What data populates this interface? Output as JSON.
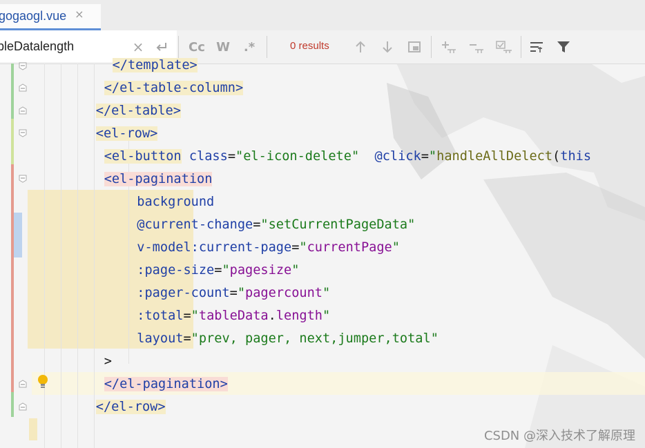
{
  "tab": {
    "label": "gogaogl.vue",
    "close": "×"
  },
  "search": {
    "value": "bleDatalength",
    "results": "0 results",
    "icons": [
      "clear-icon",
      "replace-arrow-icon",
      "match-case-icon",
      "words-icon",
      "regex-icon",
      "prev-occurrence-icon",
      "next-occurrence-icon",
      "select-all-icon",
      "add-selection-icon",
      "remove-selection-icon",
      "toggle-selection-icon",
      "filter-options-icon",
      "filter-icon"
    ],
    "match_case_label": "Cc",
    "words_label": "W",
    "regex_label": ".*"
  },
  "code": [
    {
      "indent": "        ",
      "parts": [
        [
          "tag",
          "</template>"
        ]
      ]
    },
    {
      "indent": "      ",
      "parts": [
        [
          "tag",
          "</el-table-column>"
        ]
      ]
    },
    {
      "indent": "    ",
      "parts": [
        [
          "tag",
          "</el-table>"
        ]
      ]
    },
    {
      "indent": "    ",
      "parts": [
        [
          "tag",
          "<el-row>"
        ]
      ]
    },
    {
      "indent": "      ",
      "parts": [
        [
          "tag",
          "<el-button"
        ],
        [
          "plain",
          " "
        ],
        [
          "attr",
          "class"
        ],
        [
          "plain",
          "="
        ],
        [
          "str",
          "\"el-icon-delete\""
        ],
        [
          "plain",
          "  "
        ],
        [
          "attr",
          "@click"
        ],
        [
          "plain",
          "="
        ],
        [
          "str",
          "\""
        ],
        [
          "fn",
          "handleAllDelect"
        ],
        [
          "plain",
          "("
        ],
        [
          "kw",
          "this"
        ]
      ]
    },
    {
      "indent": "      ",
      "parts": [
        [
          "tag",
          "<el-pagination"
        ]
      ]
    },
    {
      "indent": "              ",
      "parts": [
        [
          "attr",
          "background"
        ]
      ]
    },
    {
      "indent": "              ",
      "parts": [
        [
          "attr",
          "@current-change"
        ],
        [
          "plain",
          "="
        ],
        [
          "str",
          "\"setCurrentPageData\""
        ]
      ]
    },
    {
      "indent": "              ",
      "parts": [
        [
          "attr",
          "v-model:current-page"
        ],
        [
          "plain",
          "="
        ],
        [
          "str",
          "\""
        ],
        [
          "var",
          "currentPage"
        ],
        [
          "str",
          "\""
        ]
      ]
    },
    {
      "indent": "              ",
      "parts": [
        [
          "attr",
          ":page-size"
        ],
        [
          "plain",
          "="
        ],
        [
          "str",
          "\""
        ],
        [
          "var",
          "pagesize"
        ],
        [
          "str",
          "\""
        ]
      ]
    },
    {
      "indent": "              ",
      "parts": [
        [
          "attr",
          ":pager-count"
        ],
        [
          "plain",
          "="
        ],
        [
          "str",
          "\""
        ],
        [
          "var",
          "pagercount"
        ],
        [
          "str",
          "\""
        ]
      ]
    },
    {
      "indent": "              ",
      "parts": [
        [
          "attr",
          ":total"
        ],
        [
          "plain",
          "="
        ],
        [
          "str",
          "\""
        ],
        [
          "var",
          "tableData"
        ],
        [
          "plain",
          "."
        ],
        [
          "var",
          "length"
        ],
        [
          "str",
          "\""
        ]
      ]
    },
    {
      "indent": "              ",
      "parts": [
        [
          "attr",
          "layout"
        ],
        [
          "plain",
          "="
        ],
        [
          "str",
          "\"prev, pager, next,jumper,total\""
        ]
      ]
    },
    {
      "indent": "      ",
      "parts": [
        [
          "plain",
          ">"
        ]
      ]
    },
    {
      "indent": "      ",
      "parts": [
        [
          "tag",
          "</el-pagination>"
        ]
      ]
    },
    {
      "indent": "    ",
      "parts": [
        [
          "tag",
          "</el-row>"
        ]
      ]
    }
  ],
  "watermark": "CSDN @深入技术了解原理",
  "colors": {
    "tag": "#1f3fa6",
    "string": "#1b7a1b",
    "variable": "#871094",
    "function": "#6b6b18",
    "results": "#c0392b",
    "tab_underline": "#5f8fd6"
  }
}
